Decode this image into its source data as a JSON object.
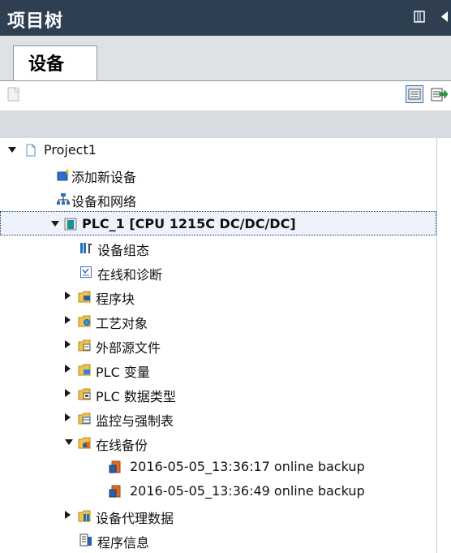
{
  "panel": {
    "title": "项目树"
  },
  "tabs": [
    {
      "label": "设备"
    }
  ],
  "icons": {
    "collapse_panel": "panel-collapse-icon",
    "pin": "arrow-left-icon",
    "add_new": "new-item-icon",
    "overview": "overview-view-icon",
    "export": "export-icon"
  },
  "tree": {
    "project": {
      "label": "Project1",
      "expanded": true
    },
    "items": [
      {
        "label": "添加新设备"
      },
      {
        "label": "设备和网络"
      },
      {
        "label": "PLC_1 [CPU 1215C DC/DC/DC]",
        "expanded": true,
        "selected": true
      },
      {
        "label": "设备组态"
      },
      {
        "label": "在线和诊断"
      },
      {
        "label": "程序块"
      },
      {
        "label": "工艺对象"
      },
      {
        "label": "外部源文件"
      },
      {
        "label": "PLC 变量"
      },
      {
        "label": "PLC 数据类型"
      },
      {
        "label": "监控与强制表"
      },
      {
        "label": "在线备份",
        "expanded": true
      },
      {
        "label": "2016-05-05_13:36:17 online backup"
      },
      {
        "label": "2016-05-05_13:36:49 online backup"
      },
      {
        "label": "设备代理数据"
      },
      {
        "label": "程序信息"
      }
    ]
  },
  "colors": {
    "titlebar": "#2f3f52",
    "tab_strip": "#dfe2e5",
    "selection_border": "#1e3a6e"
  }
}
